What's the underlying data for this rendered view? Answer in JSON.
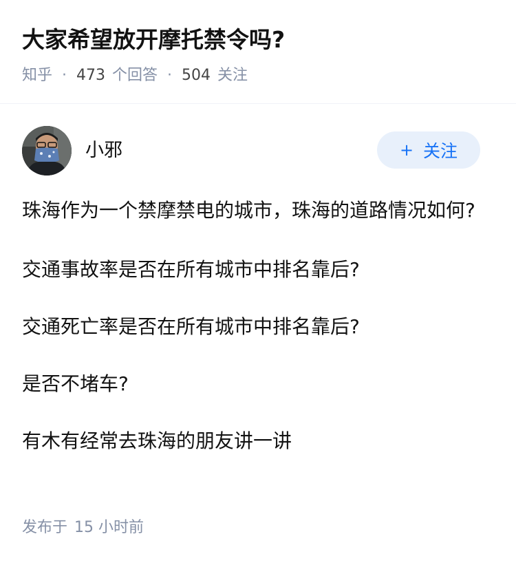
{
  "question": {
    "title": "大家希望放开摩托禁令吗?",
    "source": "知乎",
    "answer_count": "473",
    "answer_label": "个回答",
    "follow_count": "504",
    "follow_label": "关注",
    "separator": "·"
  },
  "author": {
    "name": "小邪",
    "follow_button_plus": "+",
    "follow_button_label": "关注"
  },
  "content": {
    "paragraphs": [
      "珠海作为一个禁摩禁电的城市，珠海的道路情况如何?",
      "交通事故率是否在所有城市中排名靠后?",
      "交通死亡率是否在所有城市中排名靠后?",
      "是否不堵车?",
      "有木有经常去珠海的朋友讲一讲"
    ]
  },
  "footer": {
    "publish_label": "发布于",
    "publish_time": "15 小时前"
  },
  "colors": {
    "accent": "#1772f6",
    "follow_bg": "#e8f0fb",
    "meta_text": "#8590a6",
    "main_text": "#121212"
  }
}
